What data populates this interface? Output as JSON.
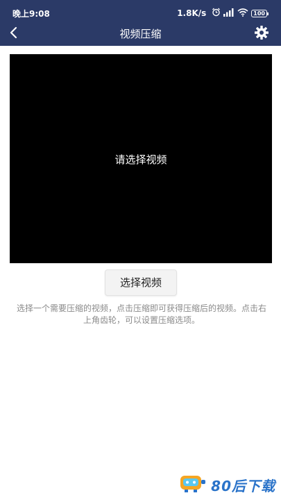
{
  "status_bar": {
    "time": "晚上9:08",
    "speed": "1.8K/s",
    "battery": "100",
    "icons": [
      "alarm-icon",
      "signal-icon",
      "wifi-icon",
      "battery-icon"
    ]
  },
  "header": {
    "title": "视频压缩",
    "background": "#2b3a67",
    "back_icon": "chevron-left-icon",
    "settings_icon": "gear-icon"
  },
  "main": {
    "video_placeholder": "请选择视频",
    "select_button_label": "选择视频",
    "hint": "选择一个需要压缩的视频，点击压缩即可获得压缩后的视频。点击右上角齿轮，可以设置压缩选项。"
  },
  "watermark": {
    "text": "80后下载"
  }
}
